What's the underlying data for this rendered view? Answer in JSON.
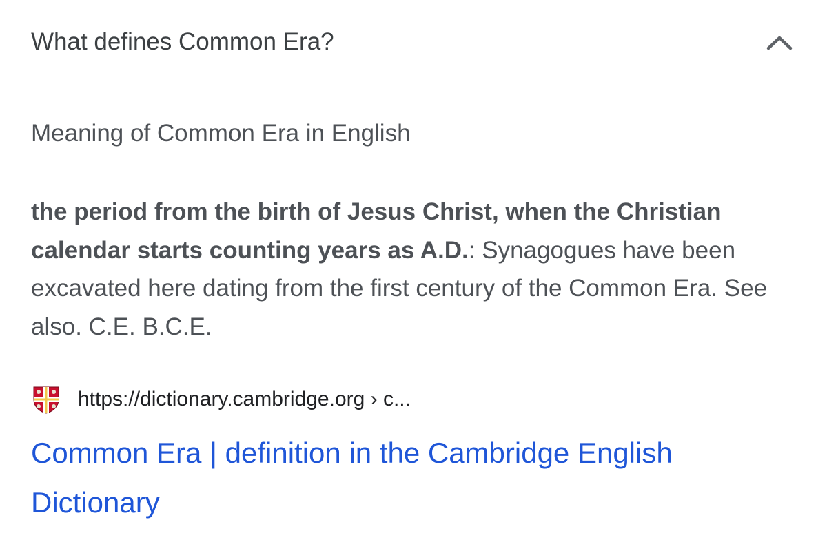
{
  "question": {
    "text": "What defines Common Era?",
    "toggle_icon": "chevron-up-icon"
  },
  "answer": {
    "heading": "Meaning of Common Era in English",
    "definition_bold": "the period from the birth of Jesus Christ, when the Christian calendar starts counting years as A.D.",
    "definition_sep": ":",
    "example": " Synagogues have been excavated here dating from the first century of the Common Era. See also. C.E. B.C.E."
  },
  "source": {
    "favicon": "cambridge-shield-icon",
    "url": "https://dictionary.cambridge.org › c...",
    "title": "Common Era | definition in the Cambridge English Dictionary"
  },
  "colors": {
    "link": "#1f56d8",
    "text": "#4d5156",
    "heading": "#3c4043"
  }
}
